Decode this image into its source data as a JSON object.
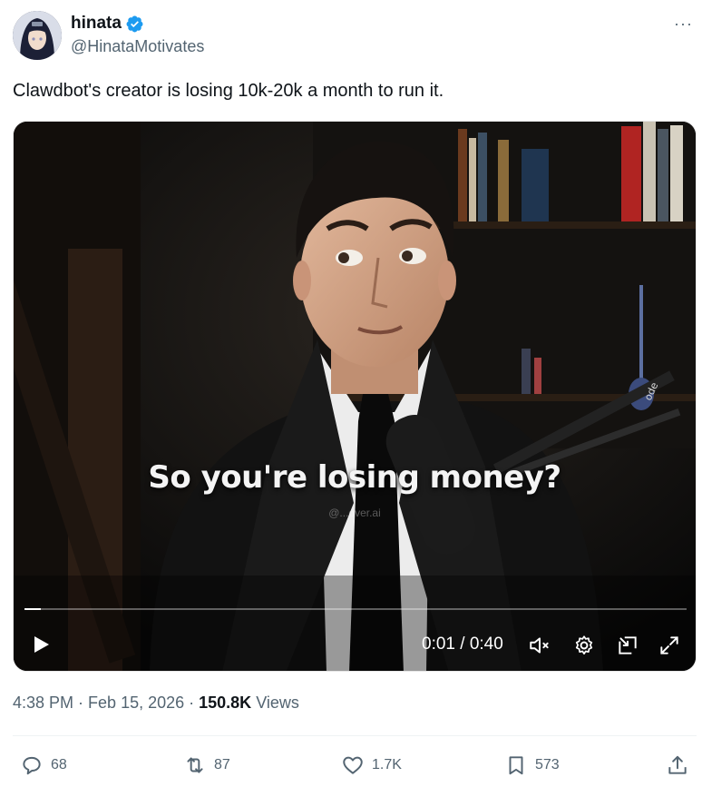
{
  "author": {
    "display_name": "hinata",
    "handle": "@HinataMotivates",
    "verified_icon": "verified-badge-icon",
    "avatar_icon": "avatar"
  },
  "more_label": "···",
  "tweet": {
    "text": "Clawdbot's creator is losing 10k-20k a month to run it."
  },
  "video": {
    "caption": "So you're losing money?",
    "watermark": "@...over.ai",
    "current_time": "0:01",
    "duration": "0:40",
    "time_display": "0:01 / 0:40",
    "progress_fraction": 0.025,
    "controls": [
      "play-icon",
      "mute-icon",
      "settings-gear-icon",
      "picture-in-picture-icon",
      "fullscreen-icon"
    ]
  },
  "meta": {
    "time": "4:38 PM",
    "separator": " · ",
    "date": "Feb 15, 2026",
    "views_count": "150.8K",
    "views_label": "Views"
  },
  "actions": {
    "replies": "68",
    "reposts": "87",
    "likes": "1.7K",
    "bookmarks": "573"
  },
  "colors": {
    "text_primary": "#0f1419",
    "text_secondary": "#536471",
    "verified_blue": "#1d9bf0",
    "divider": "#eff3f4"
  }
}
